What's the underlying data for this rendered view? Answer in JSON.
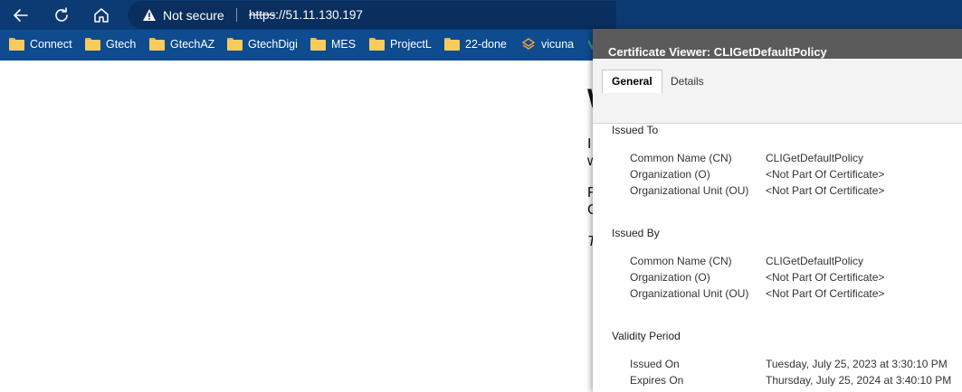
{
  "browser": {
    "security_label": "Not secure",
    "url_scheme": "https",
    "url_rest": "://51.11.130.197",
    "bookmarks": [
      "Connect",
      "Gtech",
      "GtechAZ",
      "GtechDigi",
      "MES",
      "ProjectL",
      "22-done",
      "vicuna"
    ]
  },
  "page": {
    "heading_fragment": "W",
    "line1a": "I",
    "line1b": "w",
    "line2a": "F",
    "line2b": "C",
    "line3": "T"
  },
  "dialog": {
    "title": "Certificate Viewer: CLIGetDefaultPolicy",
    "tabs": {
      "general": "General",
      "details": "Details"
    },
    "issued_to": {
      "heading": "Issued To",
      "cn_label": "Common Name (CN)",
      "cn_value": "CLIGetDefaultPolicy",
      "o_label": "Organization (O)",
      "o_value": "<Not Part Of Certificate>",
      "ou_label": "Organizational Unit (OU)",
      "ou_value": "<Not Part Of Certificate>"
    },
    "issued_by": {
      "heading": "Issued By",
      "cn_label": "Common Name (CN)",
      "cn_value": "CLIGetDefaultPolicy",
      "o_label": "Organization (O)",
      "o_value": "<Not Part Of Certificate>",
      "ou_label": "Organizational Unit (OU)",
      "ou_value": "<Not Part Of Certificate>"
    },
    "validity": {
      "heading": "Validity Period",
      "issued_on_label": "Issued On",
      "issued_on_value": "Tuesday, July 25, 2023 at 3:30:10 PM",
      "expires_on_label": "Expires On",
      "expires_on_value": "Thursday, July 25, 2024 at 3:40:10 PM"
    }
  },
  "colors": {
    "toolbar": "#0b3b72",
    "bookmarks_bar": "#0e4b8f",
    "dialog_titlebar": "#5b5b5b"
  }
}
